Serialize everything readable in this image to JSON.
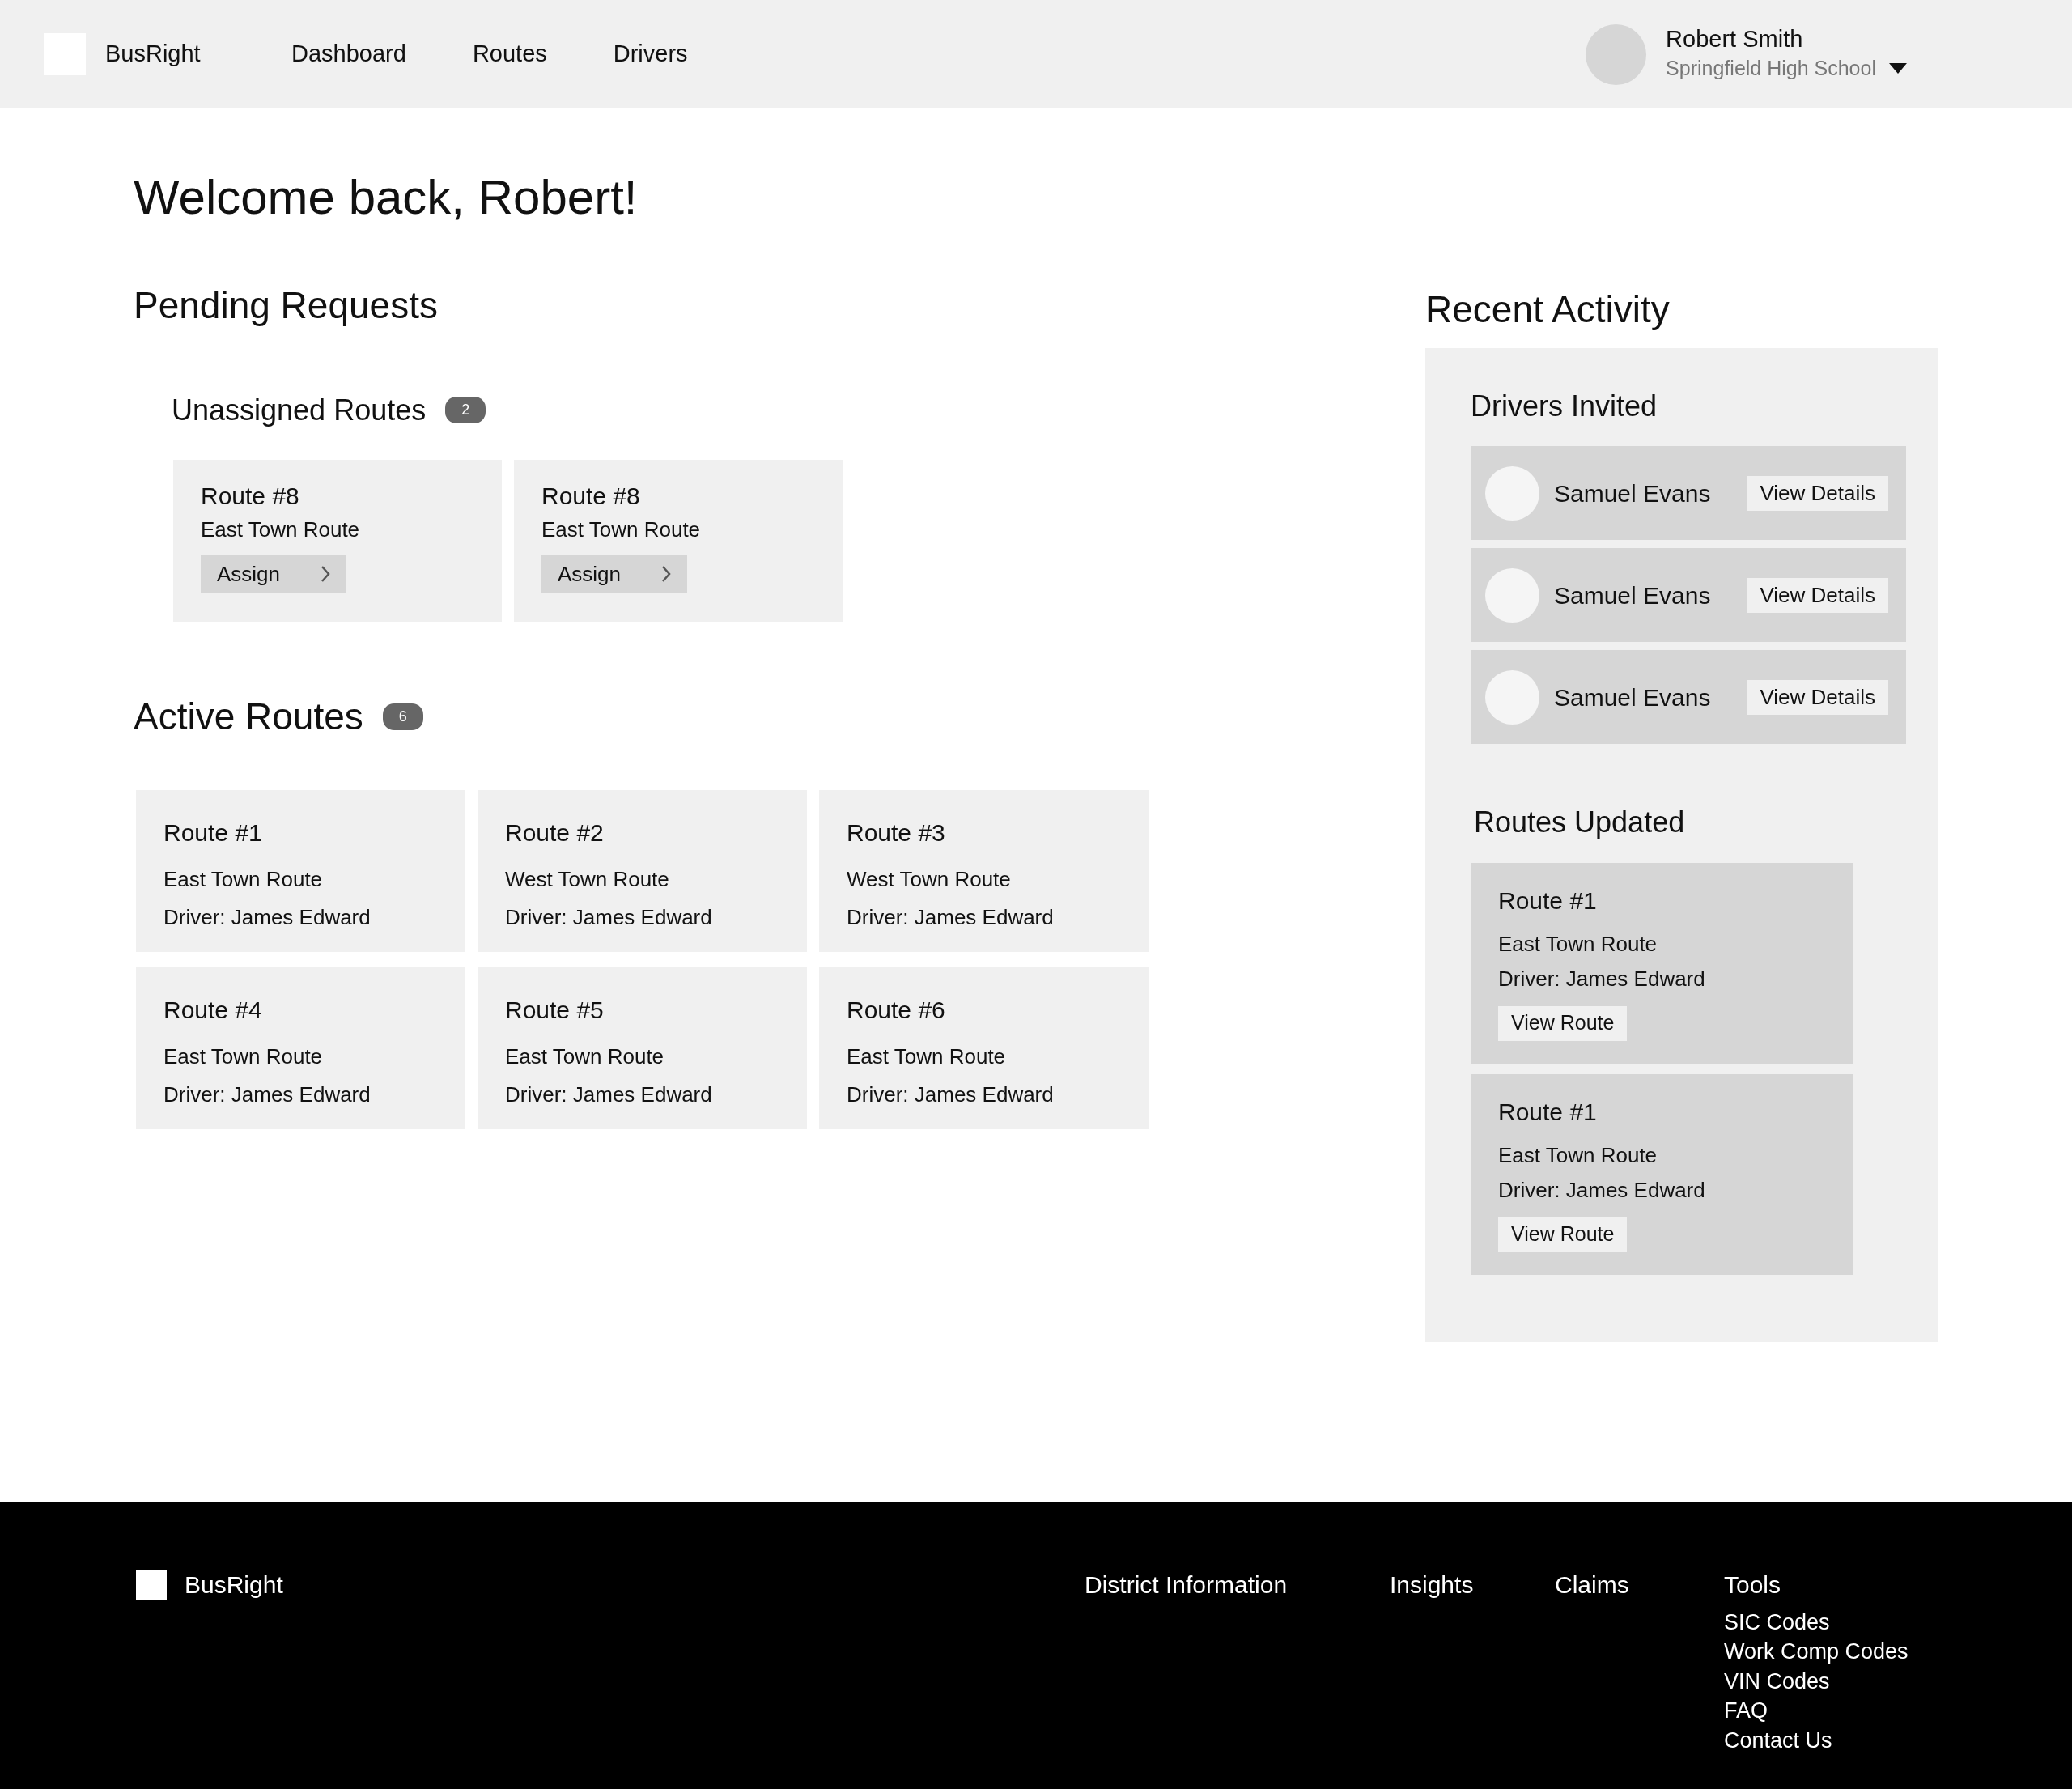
{
  "header": {
    "brand": "BusRight",
    "nav": [
      "Dashboard",
      "Routes",
      "Drivers"
    ],
    "user": {
      "name": "Robert Smith",
      "school": "Springfield High School"
    }
  },
  "welcome": "Welcome back, Robert!",
  "pending": {
    "title": "Pending Requests",
    "unassigned": {
      "title": "Unassigned Routes",
      "count": "2",
      "cards": [
        {
          "title": "Route #8",
          "subtitle": "East Town Route",
          "button": "Assign"
        },
        {
          "title": "Route #8",
          "subtitle": "East Town Route",
          "button": "Assign"
        }
      ]
    }
  },
  "active": {
    "title": "Active Routes",
    "count": "6",
    "cards": [
      {
        "title": "Route #1",
        "route": "East Town Route",
        "driver": "Driver: James Edward"
      },
      {
        "title": "Route #2",
        "route": "West Town Route",
        "driver": "Driver: James Edward"
      },
      {
        "title": "Route #3",
        "route": "West Town Route",
        "driver": "Driver: James Edward"
      },
      {
        "title": "Route #4",
        "route": "East Town Route",
        "driver": "Driver: James Edward"
      },
      {
        "title": "Route #5",
        "route": "East Town Route",
        "driver": "Driver: James Edward"
      },
      {
        "title": "Route #6",
        "route": "East Town Route",
        "driver": "Driver: James Edward"
      }
    ]
  },
  "recent": {
    "title": "Recent Activity",
    "drivers": {
      "title": "Drivers Invited",
      "items": [
        {
          "name": "Samuel Evans",
          "button": "View Details"
        },
        {
          "name": "Samuel Evans",
          "button": "View Details"
        },
        {
          "name": "Samuel Evans",
          "button": "View Details"
        }
      ]
    },
    "routes": {
      "title": "Routes Updated",
      "items": [
        {
          "title": "Route #1",
          "route": "East Town Route",
          "driver": "Driver: James Edward",
          "button": "View Route"
        },
        {
          "title": "Route #1",
          "route": "East Town Route",
          "driver": "Driver: James Edward",
          "button": "View Route"
        }
      ]
    }
  },
  "footer": {
    "brand": "BusRight",
    "columns": [
      {
        "title": "District Information"
      },
      {
        "title": "Insights"
      },
      {
        "title": "Claims"
      },
      {
        "title": "Tools",
        "links": [
          "SIC Codes",
          "Work Comp Codes",
          "VIN Codes",
          "FAQ",
          "Contact Us"
        ]
      }
    ]
  }
}
